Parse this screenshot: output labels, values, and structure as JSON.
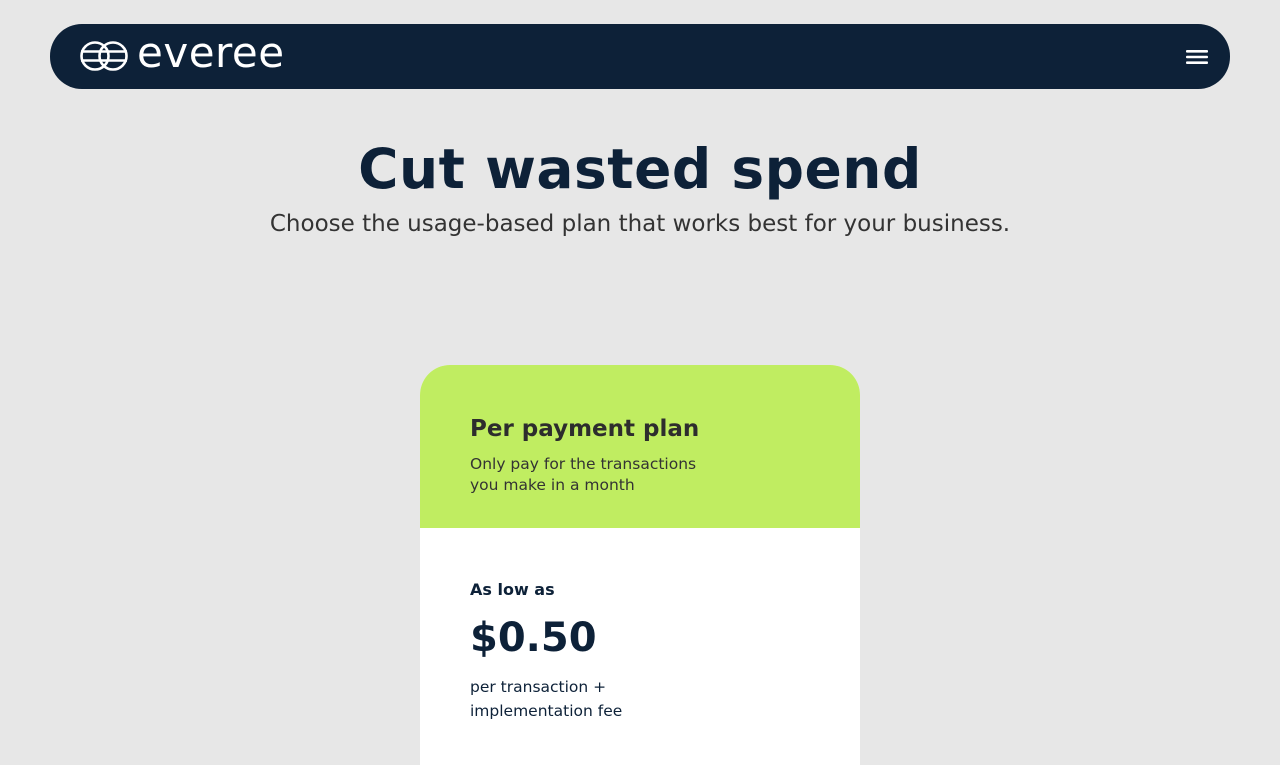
{
  "nav": {
    "logo_text": "everee",
    "logo_icon": "interlocked-rings-icon",
    "menu_icon": "hamburger-menu-icon"
  },
  "hero": {
    "title": "Cut wasted spend",
    "subtitle": "Choose the usage-based plan that works best for your business."
  },
  "plan": {
    "name": "Per payment plan",
    "description": "Only pay for the transactions you make in a month",
    "price_prefix": "As low as",
    "price": "$0.50",
    "price_note": "per transaction + implementation fee"
  },
  "colors": {
    "navy": "#0d2138",
    "lime": "#c0ed61",
    "page_background": "#e7e7e7",
    "card_body": "#ffffff"
  }
}
